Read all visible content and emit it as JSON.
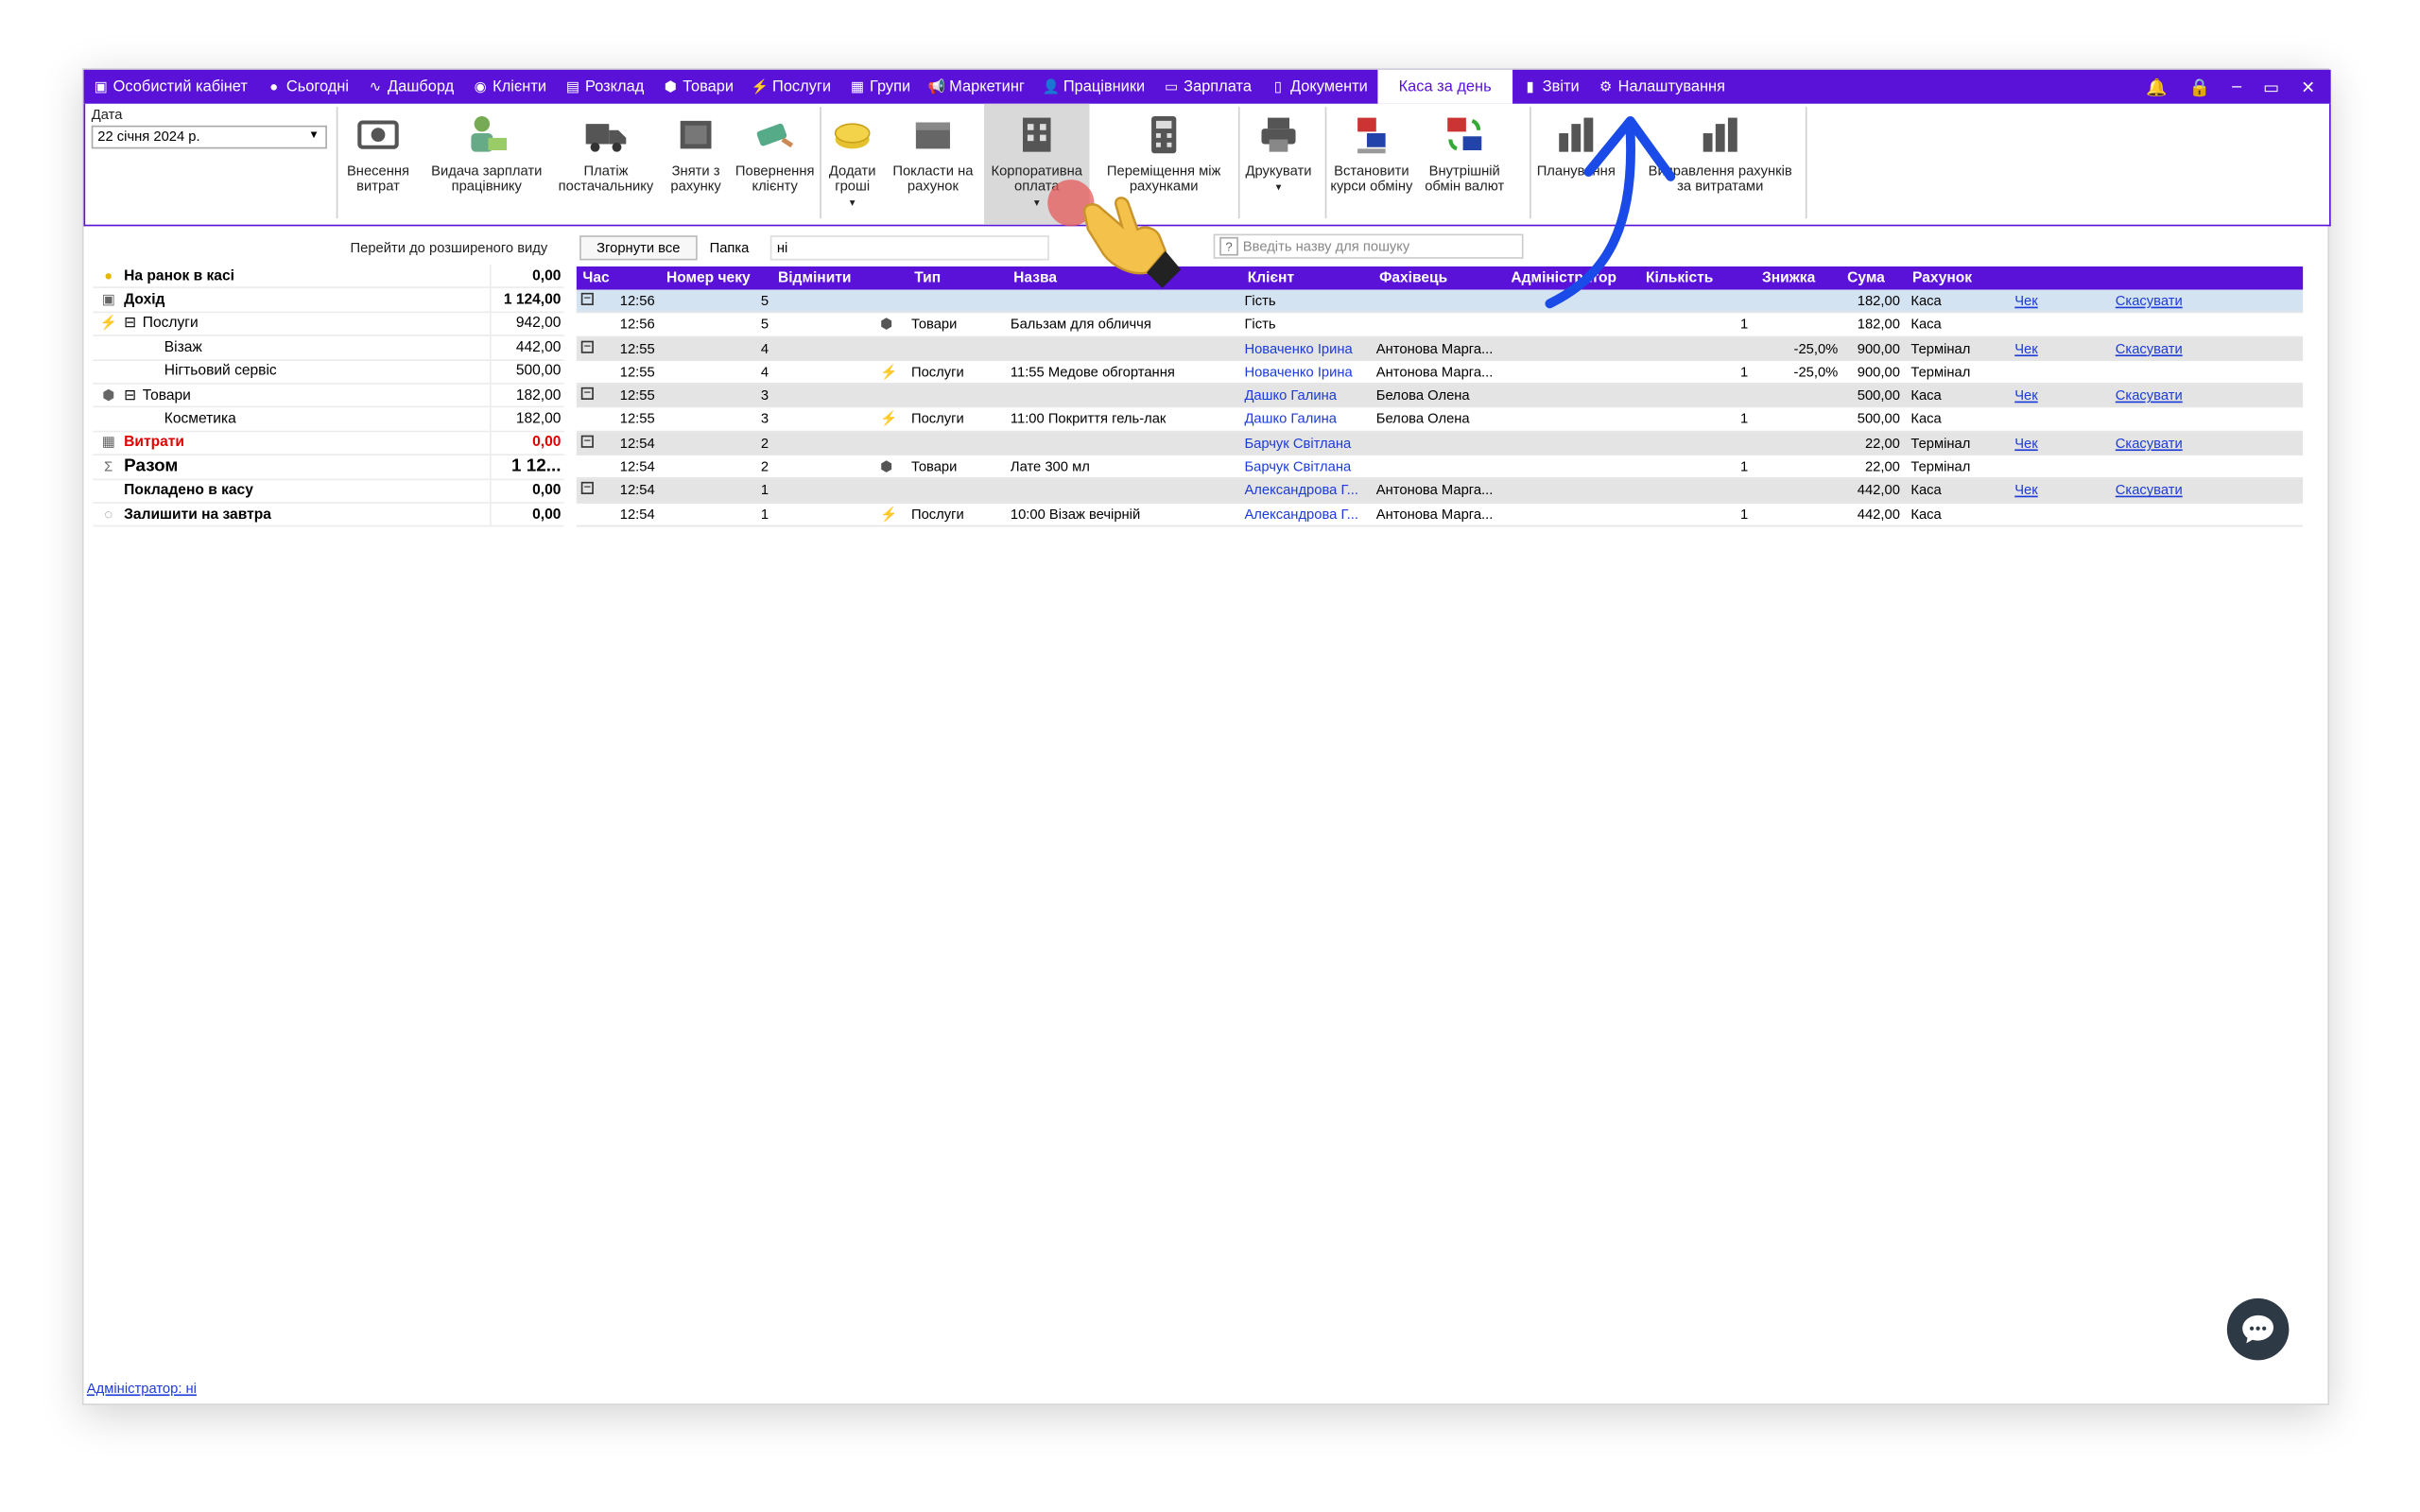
{
  "nav": {
    "tabs": [
      {
        "label": "Особистий кабінет",
        "icon": "cabinet-icon"
      },
      {
        "label": "Сьогодні",
        "icon": "today-icon"
      },
      {
        "label": "Дашборд",
        "icon": "pulse-icon"
      },
      {
        "label": "Клієнти",
        "icon": "user-circle-icon"
      },
      {
        "label": "Розклад",
        "icon": "calendar-icon"
      },
      {
        "label": "Товари",
        "icon": "box-icon"
      },
      {
        "label": "Послуги",
        "icon": "lightning-icon"
      },
      {
        "label": "Групи",
        "icon": "group-icon"
      },
      {
        "label": "Маркетинг",
        "icon": "megaphone-icon"
      },
      {
        "label": "Працівники",
        "icon": "person-icon"
      },
      {
        "label": "Зарплата",
        "icon": "money-icon"
      },
      {
        "label": "Документи",
        "icon": "document-icon"
      },
      {
        "label": "Каса за день",
        "icon": "",
        "active": true
      },
      {
        "label": "Звіти",
        "icon": "bar-chart-icon"
      },
      {
        "label": "Налаштування",
        "icon": "gear-icon"
      }
    ],
    "accent": "#5a12d8"
  },
  "ribbon": {
    "date_label": "Дата",
    "date_value": "22 січня 2024 р.",
    "buttons": [
      {
        "line1": "Внесення",
        "line2": "витрат",
        "icon": "cash-icon"
      },
      {
        "line1": "Видача зарплати",
        "line2": "працівнику",
        "icon": "salary-icon"
      },
      {
        "line1": "Платіж",
        "line2": "постачальнику",
        "icon": "truck-icon"
      },
      {
        "line1": "Зняти з",
        "line2": "рахунку",
        "icon": "safe-out-icon"
      },
      {
        "line1": "Повернення",
        "line2": "клієнту",
        "icon": "refund-icon"
      },
      {
        "line1": "Додати",
        "line2": "гроші",
        "icon": "coins-icon"
      },
      {
        "line1": "Покласти на",
        "line2": "рахунок",
        "icon": "safe-icon"
      },
      {
        "line1": "Корпоративна",
        "line2": "оплата",
        "icon": "building-icon"
      },
      {
        "line1": "Переміщення між",
        "line2": "рахунками",
        "icon": "calculator-icon"
      },
      {
        "line1": "Друкувати",
        "line2": "",
        "icon": "printer-icon"
      },
      {
        "line1": "Встановити",
        "line2": "курси обміну",
        "icon": "exchange-rate-icon"
      },
      {
        "line1": "Внутрішній",
        "line2": "обмін валют",
        "icon": "currency-swap-icon"
      },
      {
        "line1": "Планування",
        "line2": "",
        "icon": "bar-chart-icon"
      },
      {
        "line1": "Виправлення рахунків",
        "line2": "за витратами",
        "icon": "bar-chart-icon"
      }
    ]
  },
  "left": {
    "expand_link": "Перейти до розширеного виду",
    "rows": [
      {
        "icon": "coin-icon",
        "name": "На ранок в касі",
        "value": "0,00",
        "bold": true
      },
      {
        "icon": "cash-icon",
        "name": "Дохід",
        "value": "1 124,00",
        "bold": true
      },
      {
        "icon": "lightning-icon",
        "name": "Послуги",
        "value": "942,00",
        "expander": "⊟"
      },
      {
        "icon": "",
        "name": "Візаж",
        "value": "442,00",
        "indent": true
      },
      {
        "icon": "",
        "name": "Нігтьовий сервіс",
        "value": "500,00",
        "indent": true
      },
      {
        "icon": "box-icon",
        "name": "Товари",
        "value": "182,00",
        "expander": "⊟"
      },
      {
        "icon": "",
        "name": "Косметика",
        "value": "182,00",
        "indent": true
      },
      {
        "icon": "calculator-icon",
        "name": "Витрати",
        "value": "0,00",
        "bold": true,
        "red": true
      },
      {
        "icon": "sigma-icon",
        "name": "Разом",
        "value": "1 12...",
        "bold": true,
        "big": true
      },
      {
        "icon": "",
        "name": "Покладено в касу",
        "value": "0,00",
        "bold": true
      },
      {
        "icon": "piggy-icon",
        "name": "Залишити на завтра",
        "value": "0,00",
        "bold": true
      }
    ]
  },
  "toolbar": {
    "collapse_label": "Згорнути все",
    "folder_label": "Папка",
    "folder_value": "ні",
    "search_hint": "?",
    "search_placeholder": "Введіть назву для пошуку"
  },
  "grid": {
    "headers": [
      "Час",
      "Номер чеку",
      "Відмінити",
      "Тип",
      "Назва",
      "Клієнт",
      "Фахівець",
      "Адміністратор",
      "Кількість",
      "Знижка",
      "Сума",
      "Рахунок"
    ],
    "rows": [
      {
        "group": true,
        "selected": true,
        "time": "12:56",
        "num": "5",
        "type": "",
        "name": "",
        "client": "Гість",
        "client_link": false,
        "master": "",
        "qty": "",
        "disc": "",
        "sum": "182,00",
        "acc": "Каса",
        "check": "Чек",
        "cancel": "Скасувати"
      },
      {
        "group": false,
        "time": "12:56",
        "num": "5",
        "type_icon": "box-icon",
        "type": "Товари",
        "name": "Бальзам для обличчя",
        "client": "Гість",
        "client_link": false,
        "master": "",
        "qty": "1",
        "disc": "",
        "sum": "182,00",
        "acc": "Каса"
      },
      {
        "group": true,
        "time": "12:55",
        "num": "4",
        "type": "",
        "name": "",
        "client": "Новаченко Ірина",
        "client_link": true,
        "master": "Антонова Марга...",
        "qty": "",
        "disc": "-25,0%",
        "sum": "900,00",
        "acc": "Термінал",
        "check": "Чек",
        "cancel": "Скасувати"
      },
      {
        "group": false,
        "time": "12:55",
        "num": "4",
        "type_icon": "lightning-icon",
        "type": "Послуги",
        "name": "11:55 Медове обгортання",
        "client": "Новаченко Ірина",
        "client_link": true,
        "master": "Антонова Марга...",
        "qty": "1",
        "disc": "-25,0%",
        "sum": "900,00",
        "acc": "Термінал"
      },
      {
        "group": true,
        "time": "12:55",
        "num": "3",
        "type": "",
        "name": "",
        "client": "Дашко Галина",
        "client_link": true,
        "master": "Белова Олена",
        "qty": "",
        "disc": "",
        "sum": "500,00",
        "acc": "Каса",
        "check": "Чек",
        "cancel": "Скасувати"
      },
      {
        "group": false,
        "time": "12:55",
        "num": "3",
        "type_icon": "lightning-icon",
        "type": "Послуги",
        "name": "11:00 Покриття гель-лак",
        "client": "Дашко Галина",
        "client_link": true,
        "master": "Белова Олена",
        "qty": "1",
        "disc": "",
        "sum": "500,00",
        "acc": "Каса"
      },
      {
        "group": true,
        "time": "12:54",
        "num": "2",
        "type": "",
        "name": "",
        "client": "Барчук Світлана",
        "client_link": true,
        "master": "",
        "qty": "",
        "disc": "",
        "sum": "22,00",
        "acc": "Термінал",
        "check": "Чек",
        "cancel": "Скасувати"
      },
      {
        "group": false,
        "time": "12:54",
        "num": "2",
        "type_icon": "box-icon",
        "type": "Товари",
        "name": "Лате 300 мл",
        "client": "Барчук Світлана",
        "client_link": true,
        "master": "",
        "qty": "1",
        "disc": "",
        "sum": "22,00",
        "acc": "Термінал"
      },
      {
        "group": true,
        "time": "12:54",
        "num": "1",
        "type": "",
        "name": "",
        "client": "Александрова Г...",
        "client_link": true,
        "master": "Антонова Марга...",
        "qty": "",
        "disc": "",
        "sum": "442,00",
        "acc": "Каса",
        "check": "Чек",
        "cancel": "Скасувати"
      },
      {
        "group": false,
        "time": "12:54",
        "num": "1",
        "type_icon": "lightning-icon",
        "type": "Послуги",
        "name": "10:00 Візаж вечірній",
        "client": "Александрова Г...",
        "client_link": true,
        "master": "Антонова Марга...",
        "qty": "1",
        "disc": "",
        "sum": "442,00",
        "acc": "Каса"
      }
    ]
  },
  "footer": {
    "admin_link": "Адміністратор: ні"
  },
  "overlay": {
    "pointer_icon": "hand-pointer-icon",
    "arrow_icon": "curved-arrow-icon",
    "arrow_color": "#1a4be8",
    "chat_icon": "chat-bubble-icon"
  }
}
